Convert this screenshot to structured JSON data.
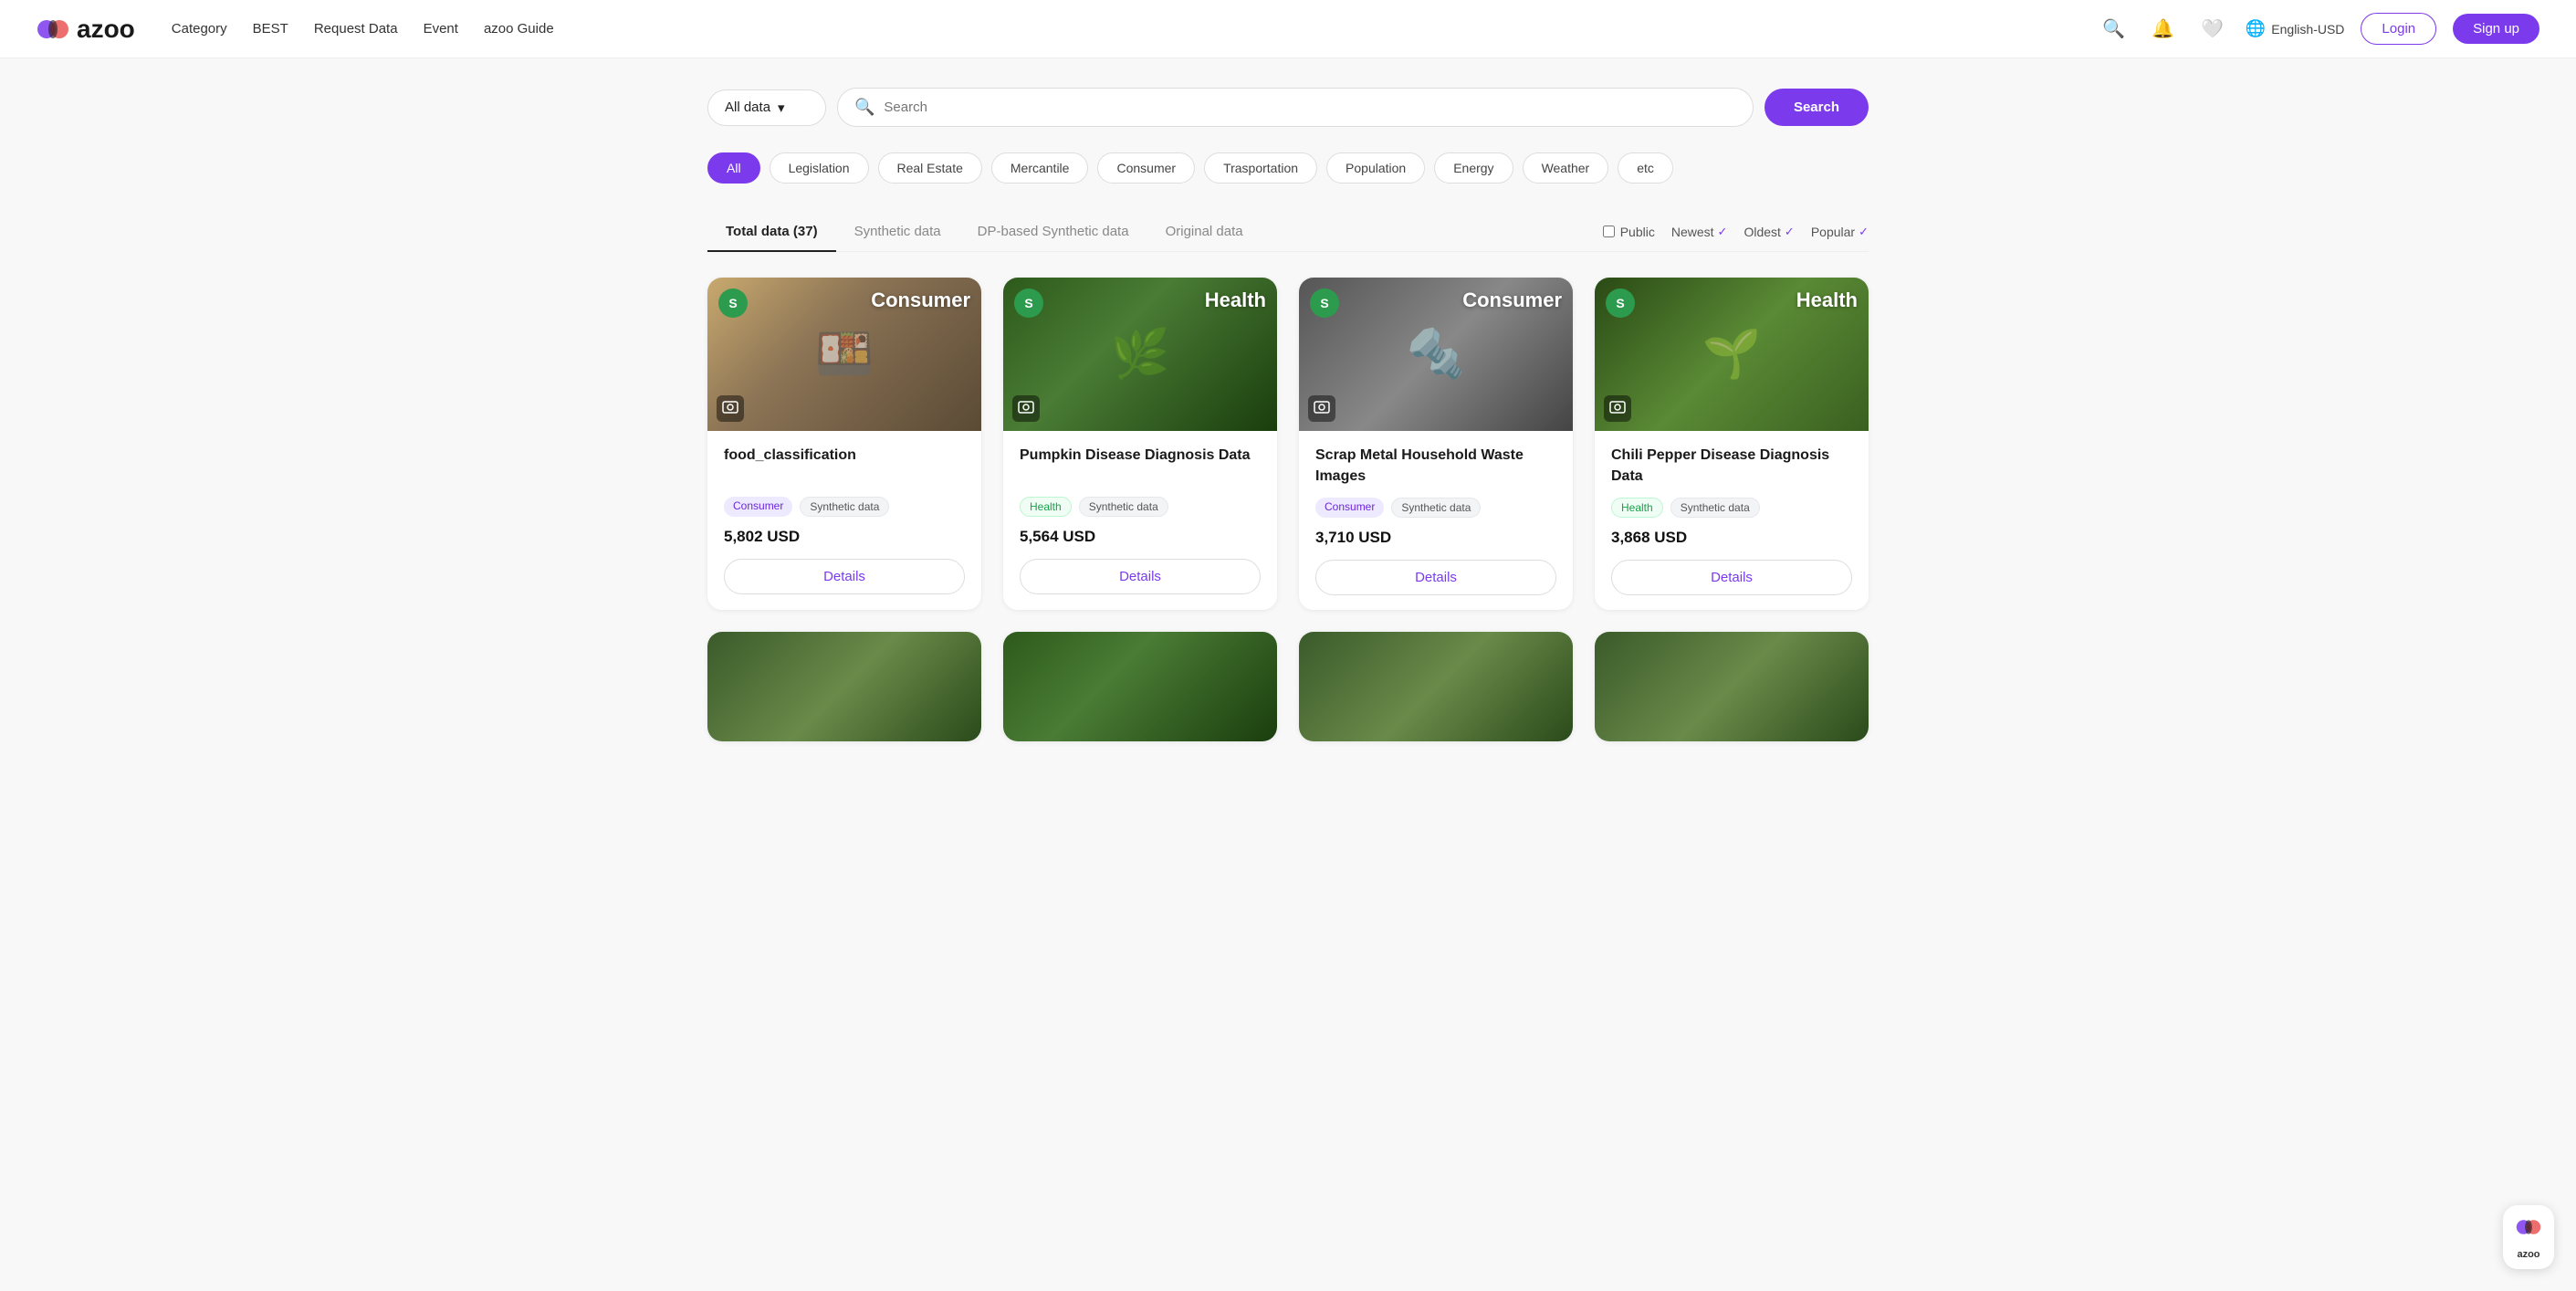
{
  "brand": {
    "name": "azoo",
    "logo_text": "azoo"
  },
  "nav": {
    "links": [
      {
        "label": "Category",
        "id": "category"
      },
      {
        "label": "BEST",
        "id": "best"
      },
      {
        "label": "Request Data",
        "id": "request-data"
      },
      {
        "label": "Event",
        "id": "event"
      },
      {
        "label": "azoo Guide",
        "id": "azoo-guide"
      }
    ],
    "login_label": "Login",
    "signup_label": "Sign up",
    "lang_label": "English-USD"
  },
  "search": {
    "data_type_label": "All data",
    "placeholder": "Search",
    "button_label": "Search"
  },
  "filters": [
    {
      "label": "All",
      "id": "all",
      "active": true
    },
    {
      "label": "Legislation",
      "id": "legislation",
      "active": false
    },
    {
      "label": "Real Estate",
      "id": "real-estate",
      "active": false
    },
    {
      "label": "Mercantile",
      "id": "mercantile",
      "active": false
    },
    {
      "label": "Consumer",
      "id": "consumer",
      "active": false
    },
    {
      "label": "Trasportation",
      "id": "transportation",
      "active": false
    },
    {
      "label": "Population",
      "id": "population",
      "active": false
    },
    {
      "label": "Energy",
      "id": "energy",
      "active": false
    },
    {
      "label": "Weather",
      "id": "weather",
      "active": false
    },
    {
      "label": "etc",
      "id": "etc",
      "active": false
    }
  ],
  "tabs": {
    "items": [
      {
        "label": "Total data (37)",
        "id": "total",
        "active": true
      },
      {
        "label": "Synthetic data",
        "id": "synthetic",
        "active": false
      },
      {
        "label": "DP-based Synthetic data",
        "id": "dp-synthetic",
        "active": false
      },
      {
        "label": "Original data",
        "id": "original",
        "active": false
      }
    ],
    "sort_options": [
      {
        "label": "Public",
        "type": "checkbox"
      },
      {
        "label": "Newest",
        "type": "sort",
        "checked": true
      },
      {
        "label": "Oldest",
        "type": "sort",
        "checked": true
      },
      {
        "label": "Popular",
        "type": "sort",
        "checked": true
      }
    ]
  },
  "cards": [
    {
      "id": "card-1",
      "badge": "S",
      "category_label": "Consumer",
      "image_class": "img-food",
      "title": "food_classification",
      "tags": [
        {
          "label": "Consumer",
          "type": "consumer"
        },
        {
          "label": "Synthetic data",
          "type": "synthetic"
        }
      ],
      "price": "5,802 USD",
      "details_label": "Details"
    },
    {
      "id": "card-2",
      "badge": "S",
      "category_label": "Health",
      "image_class": "img-pumpkin",
      "title": "Pumpkin Disease Diagnosis Data",
      "tags": [
        {
          "label": "Health",
          "type": "health"
        },
        {
          "label": "Synthetic data",
          "type": "synthetic"
        }
      ],
      "price": "5,564 USD",
      "details_label": "Details"
    },
    {
      "id": "card-3",
      "badge": "S",
      "category_label": "Consumer",
      "image_class": "img-scrap",
      "title": "Scrap Metal Household Waste Images",
      "tags": [
        {
          "label": "Consumer",
          "type": "consumer"
        },
        {
          "label": "Synthetic data",
          "type": "synthetic"
        }
      ],
      "price": "3,710 USD",
      "details_label": "Details"
    },
    {
      "id": "card-4",
      "badge": "S",
      "category_label": "Health",
      "image_class": "img-chili",
      "title": "Chili Pepper Disease Diagnosis Data",
      "tags": [
        {
          "label": "Health",
          "type": "health"
        },
        {
          "label": "Synthetic data",
          "type": "synthetic"
        }
      ],
      "price": "3,868 USD",
      "details_label": "Details"
    }
  ],
  "bottom_cards": [
    {
      "id": "bc-1",
      "image_class": "img-bottom"
    },
    {
      "id": "bc-2",
      "image_class": "img-pumpkin"
    },
    {
      "id": "bc-3",
      "image_class": "img-bottom"
    },
    {
      "id": "bc-4",
      "image_class": "img-bottom"
    }
  ],
  "floating_logo": {
    "text": "azoo"
  }
}
